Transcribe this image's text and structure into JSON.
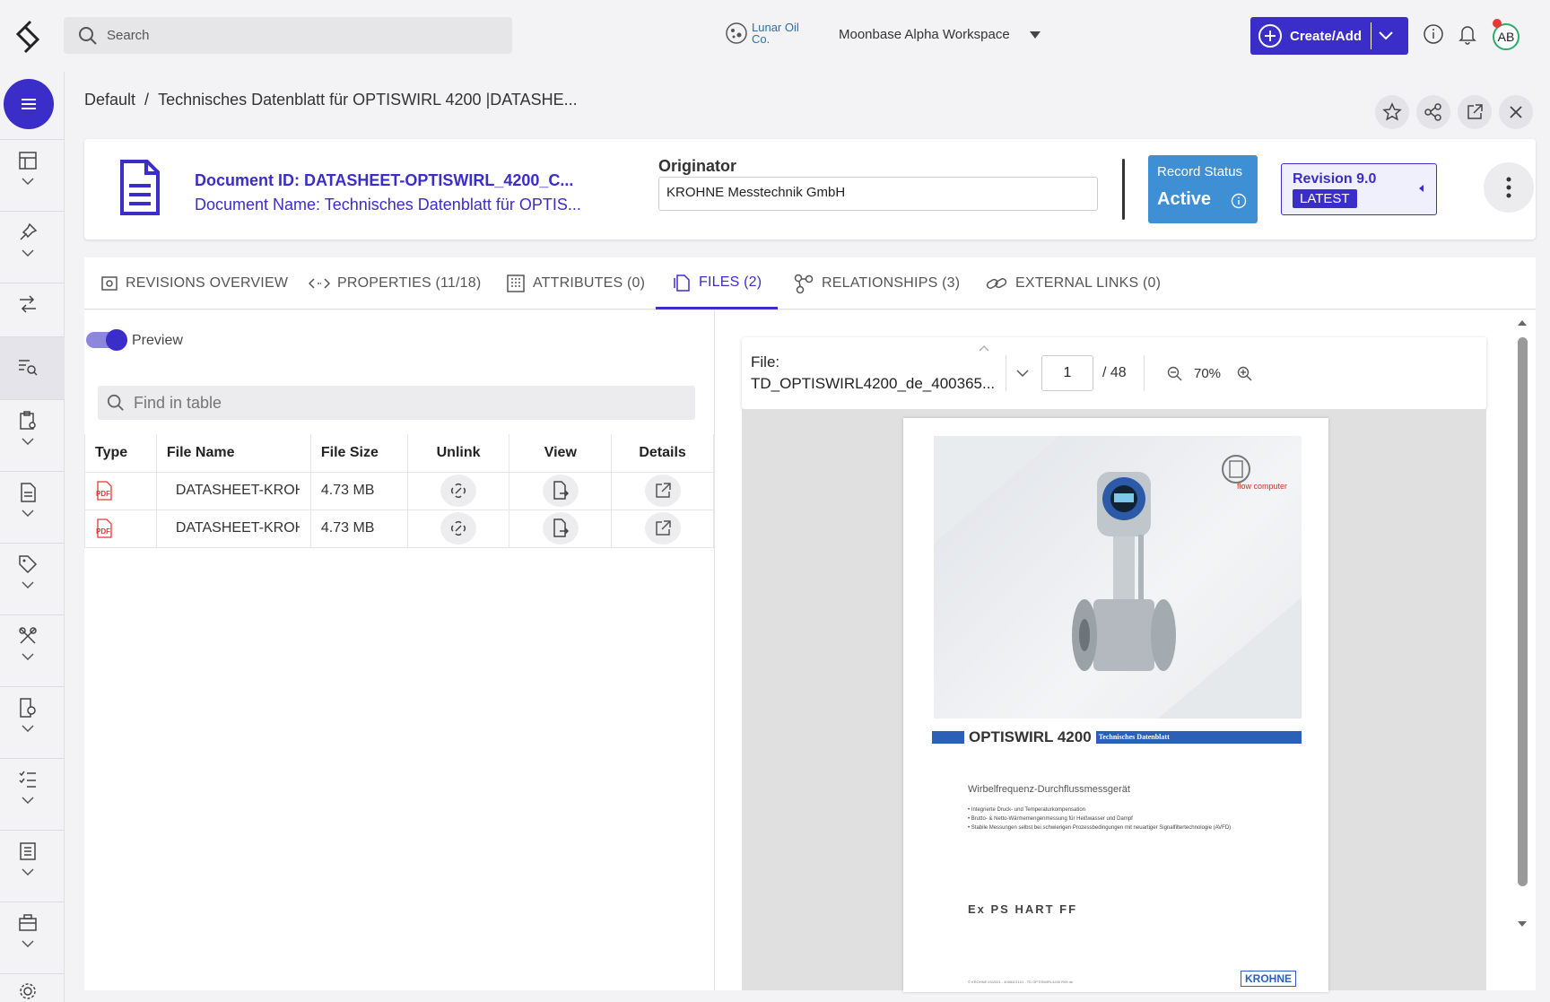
{
  "header": {
    "search_placeholder": "Search",
    "company_name": "Lunar Oil Co.",
    "workspace": "Moonbase Alpha Workspace",
    "create_label": "Create/Add",
    "avatar_initials": "AB"
  },
  "breadcrumb": {
    "root": "Default",
    "separator": "/",
    "current": "Technisches Datenblatt für OPTISWIRL 4200 |DATASHE..."
  },
  "record": {
    "doc_id": "Document ID: DATASHEET-OPTISWIRL_4200_C...",
    "doc_name": "Document Name: Technisches Datenblatt für OPTIS...",
    "originator_label": "Originator",
    "originator_value": "KROHNE Messtechnik GmbH",
    "status_label": "Record Status",
    "status_value": "Active",
    "revision_label": "Revision 9.0",
    "revision_badge": "LATEST"
  },
  "tabs": [
    {
      "label": "REVISIONS OVERVIEW",
      "icon": "revisions-icon"
    },
    {
      "label": "PROPERTIES (11/18)",
      "icon": "code-icon"
    },
    {
      "label": "ATTRIBUTES (0)",
      "icon": "grid-icon"
    },
    {
      "label": "FILES (2)",
      "icon": "files-icon",
      "active": true
    },
    {
      "label": "RELATIONSHIPS (3)",
      "icon": "relationships-icon"
    },
    {
      "label": "EXTERNAL LINKS (0)",
      "icon": "link-icon"
    }
  ],
  "files_panel": {
    "preview_label": "Preview",
    "preview_on": true,
    "find_placeholder": "Find in table",
    "columns": [
      "Type",
      "File Name",
      "File Size",
      "Unlink",
      "View",
      "Details"
    ],
    "rows": [
      {
        "type": "PDF",
        "name": "DATASHEET-KROH",
        "size": "4.73 MB"
      },
      {
        "type": "PDF",
        "name": "DATASHEET-KROH",
        "size": "4.73 MB"
      }
    ]
  },
  "viewer": {
    "file_label": "File:",
    "file_name": "TD_OPTISWIRL4200_de_400365...",
    "page": "1",
    "page_total": "/ 48",
    "zoom": "70%",
    "pdf": {
      "title": "OPTISWIRL 4200",
      "banner": "Technisches Datenblatt",
      "subtitle": "Wirbelfrequenz-Durchflussmessgerät",
      "bullets": [
        "Integrierte Druck- und Temperaturkompensation",
        "Brutto- & Netto-Wärmemengenmessung für Heißwasser und Dampf",
        "Stabile Messungen selbst bei schwierigen Prozessbedingungen mit neuartiger Signalfiltertechnologie (AVFD)"
      ],
      "logos": "Ex  PS  HART  FF",
      "brand": "KROHNE",
      "footer": "© KROHNE 03/2021 - 4008421101 - TD OPTISWIRL4200 R09 de",
      "flow_computer": "flow computer"
    }
  },
  "colors": {
    "accent": "#3b2dc8",
    "status": "#3f8fd4"
  }
}
